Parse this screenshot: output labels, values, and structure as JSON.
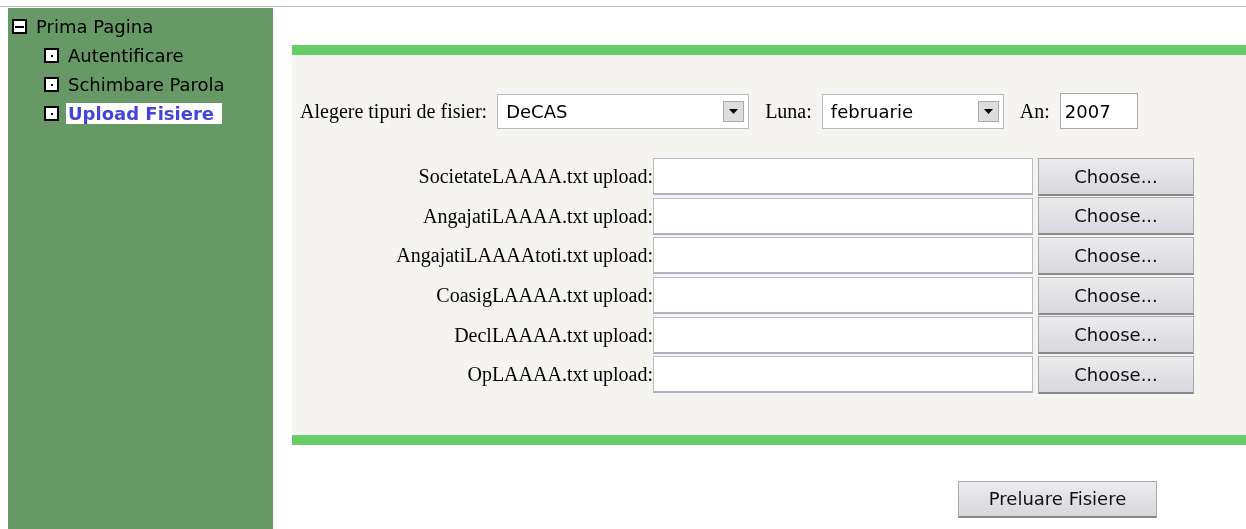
{
  "tree": {
    "label": "Prima Pagina",
    "expanded": true,
    "children": [
      {
        "label": "Autentificare",
        "selected": false
      },
      {
        "label": "Schimbare Parola",
        "selected": false
      },
      {
        "label": "Upload Fisiere",
        "selected": true
      }
    ]
  },
  "filters": {
    "type_label": "Alegere tipuri de fisier:",
    "type_value": "DeCAS",
    "month_label": "Luna:",
    "month_value": "februarie",
    "year_label": "An:",
    "year_value": "2007"
  },
  "uploads": [
    {
      "label": "SocietateLAAAA.txt upload:",
      "button": "Choose..."
    },
    {
      "label": "AngajatiLAAAA.txt upload:",
      "button": "Choose..."
    },
    {
      "label": "AngajatiLAAAAtoti.txt upload:",
      "button": "Choose..."
    },
    {
      "label": "CoasigLAAAA.txt upload:",
      "button": "Choose..."
    },
    {
      "label": "DeclLAAAA.txt upload:",
      "button": "Choose..."
    },
    {
      "label": "OpLAAAA.txt upload:",
      "button": "Choose..."
    }
  ],
  "submit": "Preluare Fisiere"
}
